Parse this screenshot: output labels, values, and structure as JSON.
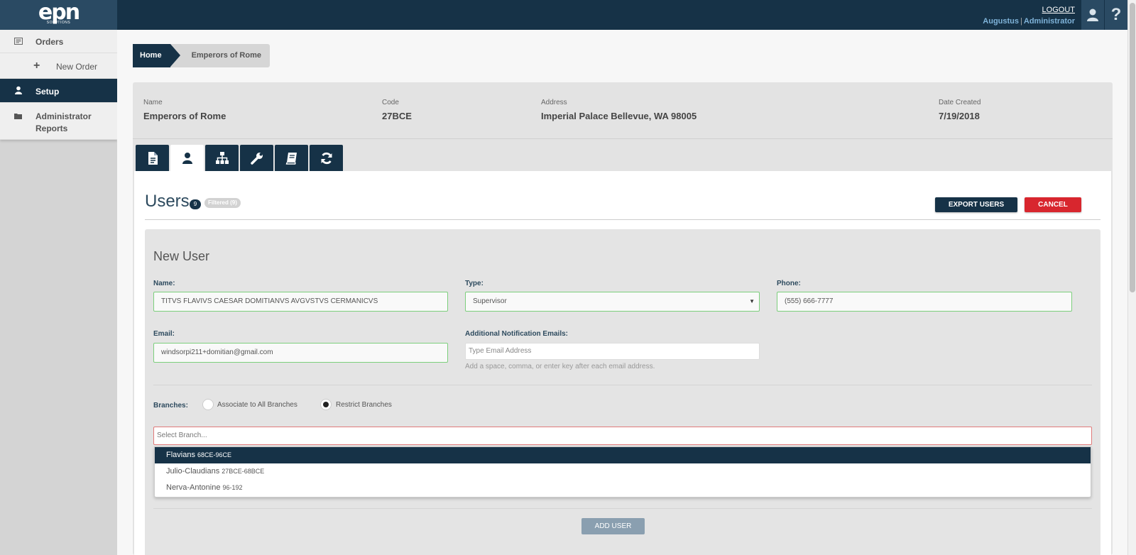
{
  "header": {
    "logo_text": "epn",
    "logo_sub": "SOLUTIONS",
    "logout_label": "LOGOUT",
    "user_name": "Augustus",
    "separator": "|",
    "user_role": "Administrator",
    "help_glyph": "?"
  },
  "sidebar": {
    "items": [
      {
        "label": "Orders",
        "icon": "orders-icon"
      },
      {
        "label": "New Order",
        "icon": "plus-icon"
      },
      {
        "label": "Setup",
        "icon": "user-icon",
        "active": true
      },
      {
        "label": "Administrator Reports",
        "icon": "folder-icon"
      }
    ]
  },
  "breadcrumb": {
    "home": "Home",
    "current": "Emperors of Rome"
  },
  "info": {
    "name_label": "Name",
    "name_value": "Emperors of Rome",
    "code_label": "Code",
    "code_value": "27BCE",
    "address_label": "Address",
    "address_value": "Imperial Palace Bellevue, WA 98005",
    "date_label": "Date Created",
    "date_value": "7/19/2018"
  },
  "tabs": [
    "document-icon",
    "user-icon",
    "org-chart-icon",
    "wrench-icon",
    "book-icon",
    "sync-icon"
  ],
  "users": {
    "title": "Users",
    "count": "9",
    "filtered": "Filtered (9)",
    "export_label": "EXPORT USERS",
    "cancel_label": "CANCEL"
  },
  "new_user": {
    "title": "New User",
    "name_label": "Name:",
    "name_value": "TITVS FLAVIVS CAESAR DOMITIANVS AVGVSTVS CERMANICVS",
    "type_label": "Type:",
    "type_value": "Supervisor",
    "phone_label": "Phone:",
    "phone_value": "(555) 666-7777",
    "email_label": "Email:",
    "email_value": "windsorpi211+domitian@gmail.com",
    "notif_label": "Additional Notification Emails:",
    "notif_placeholder": "Type Email Address",
    "notif_hint": "Add a space, comma, or enter key after each email address.",
    "branches_label": "Branches:",
    "radio_all": "Associate to All Branches",
    "radio_restrict": "Restrict Branches",
    "branch_placeholder": "Select Branch...",
    "branch_options": [
      {
        "name": "Flavians",
        "years": "68CE-96CE",
        "selected": true
      },
      {
        "name": "Julio-Claudians",
        "years": "27BCE-68BCE"
      },
      {
        "name": "Nerva-Antonine",
        "years": "96-192"
      }
    ],
    "add_label": "ADD USER"
  },
  "colors": {
    "navy": "#163247",
    "cancel_red": "#d8262e",
    "valid_green": "#7ccf7c",
    "error_red": "#e07a7a"
  }
}
